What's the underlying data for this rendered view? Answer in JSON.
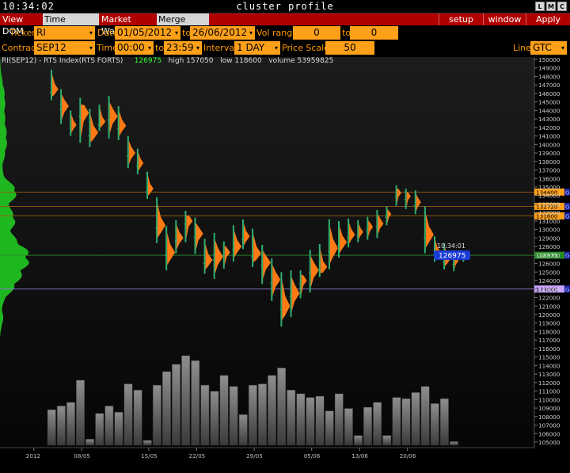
{
  "window": {
    "clock": "10:34:02",
    "title": "cluster profile",
    "buttons": [
      "L",
      "M",
      "C"
    ]
  },
  "menu": {
    "tabs": [
      {
        "label": "View DOM",
        "style": "red"
      },
      {
        "label": "Time Interval",
        "style": "active"
      },
      {
        "label": "Market Watch",
        "style": "red"
      },
      {
        "label": "Merge Contr",
        "style": "active"
      }
    ],
    "setup": "setup",
    "window": "window",
    "apply": "Apply"
  },
  "controls": {
    "ticker_label": "Ticker",
    "ticker": "RI",
    "date_label": "Date",
    "date_from": "01/05/2012",
    "date_to_label": "to",
    "date_to": "26/06/2012",
    "vol_range_label": "Vol range",
    "vol_from": "0",
    "vol_to_label": "to",
    "vol_to": "0",
    "contract_label": "Contract",
    "contract": "SEP12",
    "time_label": "Time",
    "time_from": "00:00",
    "time_to_label": "to",
    "time_to": "23:59",
    "interval_label": "Interval",
    "interval": "1 DAY",
    "price_scale_label": "Price Scale",
    "price_scale": "50",
    "line_label": "Line",
    "line": "GTC",
    "dropdown_arrow": "▾"
  },
  "info": {
    "instrument": "RI(SEP12)  -  RTS Index(RTS FORTS)",
    "last": "126975",
    "high_label": "high",
    "high": "157050",
    "low_label": "low",
    "low": "118600",
    "volume_label": "volume",
    "volume": "53959825"
  },
  "colors": {
    "profile_green": "#21c121",
    "cluster_orange": "#ff7a14",
    "cluster_green": "#2fae6e",
    "level_orange": "#ffa019",
    "level_blue": "#1a3bd6",
    "level_violet": "#c8a2ff",
    "last_line": "#2a8a2a"
  },
  "chart_data": {
    "type": "bar",
    "y_axis": {
      "min": 105000,
      "max": 150000,
      "step": 1000,
      "tick_labels": [
        "150000",
        "149000",
        "148000",
        "147000",
        "146000",
        "145000",
        "144000",
        "143000",
        "142000",
        "141000",
        "140000",
        "139000",
        "138000",
        "137000",
        "136000",
        "135000",
        "134000",
        "133000",
        "132000",
        "131000",
        "130000",
        "129000",
        "128000",
        "127000",
        "126000",
        "125000",
        "124000",
        "123000",
        "122000",
        "121000",
        "120000",
        "119000",
        "118000",
        "117000",
        "116000",
        "115000",
        "114000",
        "113000",
        "112000",
        "111000",
        "110000",
        "109000",
        "108000",
        "107000",
        "106000",
        "105000"
      ]
    },
    "x_axis": {
      "labels": [
        "2012",
        "08/05",
        "15/05",
        "22/05",
        "29/05",
        "05/06",
        "13/06",
        "20/06"
      ],
      "label_bar_index": [
        -2,
        3,
        10,
        15,
        21,
        27,
        32,
        37
      ]
    },
    "levels": [
      {
        "value": 134400,
        "label": "134400",
        "kind": "orange"
      },
      {
        "value": 132720,
        "label": "132720",
        "kind": "orange"
      },
      {
        "value": 131600,
        "label": "131600",
        "kind": "orange"
      },
      {
        "value": 126975,
        "label": "126975",
        "kind": "last",
        "time": "10:34:01"
      },
      {
        "value": 123000,
        "label": "123000",
        "kind": "violet"
      }
    ],
    "clusters": [
      {
        "high": 148800,
        "low": 145200,
        "poc": 146500
      },
      {
        "high": 146500,
        "low": 142400,
        "poc": 144500
      },
      {
        "high": 144000,
        "low": 141000,
        "poc": 142300
      },
      {
        "high": 145500,
        "low": 140200,
        "poc": 143700
      },
      {
        "high": 144200,
        "low": 139700,
        "poc": 141400
      },
      {
        "high": 144700,
        "low": 141600,
        "poc": 142700
      },
      {
        "high": 145700,
        "low": 140700,
        "poc": 143300
      },
      {
        "high": 144500,
        "low": 140500,
        "poc": 142200
      },
      {
        "high": 141000,
        "low": 137200,
        "poc": 139000
      },
      {
        "high": 139500,
        "low": 136500,
        "poc": 137800
      },
      {
        "high": 136800,
        "low": 133600,
        "poc": 134800
      },
      {
        "high": 133800,
        "low": 128400,
        "poc": 130500
      },
      {
        "high": 130400,
        "low": 125200,
        "poc": 127300
      },
      {
        "high": 131100,
        "low": 127200,
        "poc": 129000
      },
      {
        "high": 132200,
        "low": 128500,
        "poc": 131000
      },
      {
        "high": 131400,
        "low": 127100,
        "poc": 129500
      },
      {
        "high": 128900,
        "low": 124800,
        "poc": 126400
      },
      {
        "high": 129600,
        "low": 124200,
        "poc": 126800
      },
      {
        "high": 128600,
        "low": 125400,
        "poc": 127300
      },
      {
        "high": 130500,
        "low": 126200,
        "poc": 128000
      },
      {
        "high": 131200,
        "low": 127700,
        "poc": 129200
      },
      {
        "high": 130100,
        "low": 125600,
        "poc": 127200
      },
      {
        "high": 128200,
        "low": 123600,
        "poc": 126100
      },
      {
        "high": 126600,
        "low": 121600,
        "poc": 124100
      },
      {
        "high": 125000,
        "low": 118600,
        "poc": 121000
      },
      {
        "high": 125200,
        "low": 119700,
        "poc": 122500
      },
      {
        "high": 125200,
        "low": 121900,
        "poc": 124000
      },
      {
        "high": 127600,
        "low": 122600,
        "poc": 125200
      },
      {
        "high": 128300,
        "low": 124400,
        "poc": 125600
      },
      {
        "high": 131200,
        "low": 125300,
        "poc": 127800
      },
      {
        "high": 131000,
        "low": 126700,
        "poc": 128500
      },
      {
        "high": 131300,
        "low": 127900,
        "poc": 129400
      },
      {
        "high": 131100,
        "low": 128500,
        "poc": 129700
      },
      {
        "high": 131500,
        "low": 128800,
        "poc": 130300
      },
      {
        "high": 132300,
        "low": 129000,
        "poc": 130700
      },
      {
        "high": 132700,
        "low": 130500,
        "poc": 131800
      },
      {
        "high": 135200,
        "low": 132800,
        "poc": 134300
      },
      {
        "high": 134800,
        "low": 132400,
        "poc": 133900
      },
      {
        "high": 134600,
        "low": 131800,
        "poc": 133200
      },
      {
        "high": 132700,
        "low": 127200,
        "poc": 129400
      },
      {
        "high": 129200,
        "low": 126200,
        "poc": 127400
      },
      {
        "high": 128400,
        "low": 125300,
        "poc": 126500
      },
      {
        "high": 127400,
        "low": 125100,
        "poc": 126300
      },
      {
        "high": 127100,
        "low": 126200,
        "poc": 126900
      }
    ],
    "volumes": [
      29,
      32,
      35,
      53,
      5,
      26,
      32,
      27,
      50,
      45,
      4,
      49,
      60,
      66,
      73,
      69,
      49,
      44,
      57,
      48,
      25,
      49,
      50,
      57,
      63,
      45,
      42,
      39,
      40,
      28,
      42,
      30,
      8,
      31,
      35,
      8,
      39,
      38,
      43,
      48,
      34,
      38,
      3,
      0
    ]
  }
}
